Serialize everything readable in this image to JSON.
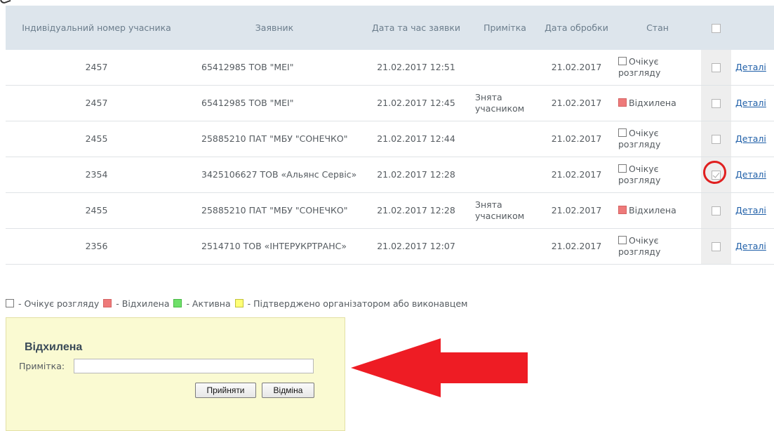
{
  "table": {
    "headers": {
      "number": "Індивідуальний номер учасника",
      "applicant": "Заявник",
      "date": "Дата та час заявки",
      "note": "Примітка",
      "processed": "Дата обробки",
      "status": "Стан"
    },
    "rows": [
      {
        "number": "2457",
        "applicant": "65412985 ТОВ \"МЕІ\"",
        "date": "21.02.2017 12:51",
        "note": "",
        "processed": "21.02.2017",
        "status": "Очікує розгляду",
        "status_type": "waiting",
        "checked": false,
        "link": "Деталі"
      },
      {
        "number": "2457",
        "applicant": "65412985 ТОВ \"МЕІ\"",
        "date": "21.02.2017 12:45",
        "note": "Знята учасником",
        "processed": "21.02.2017",
        "status": "Відхилена",
        "status_type": "rejected",
        "checked": false,
        "link": "Деталі"
      },
      {
        "number": "2455",
        "applicant": "25885210 ПАТ \"МБУ \"СОНЕЧКО\"",
        "date": "21.02.2017 12:44",
        "note": "",
        "processed": "21.02.2017",
        "status": "Очікує розгляду",
        "status_type": "waiting",
        "checked": false,
        "link": "Деталі"
      },
      {
        "number": "2354",
        "applicant": "3425106627 ТОВ «Альянс Сервіс»",
        "date": "21.02.2017 12:28",
        "note": "",
        "processed": "21.02.2017",
        "status": "Очікує розгляду",
        "status_type": "waiting",
        "checked": true,
        "link": "Деталі"
      },
      {
        "number": "2455",
        "applicant": "25885210 ПАТ \"МБУ \"СОНЕЧКО\"",
        "date": "21.02.2017 12:28",
        "note": "Знята учасником",
        "processed": "21.02.2017",
        "status": "Відхилена",
        "status_type": "rejected",
        "checked": false,
        "link": "Деталі"
      },
      {
        "number": "2356",
        "applicant": "2514710 ТОВ «ІНТЕРУКРТРАНС»",
        "date": "21.02.2017 12:07",
        "note": "",
        "processed": "21.02.2017",
        "status": "Очікує розгляду",
        "status_type": "waiting",
        "checked": false,
        "link": "Деталі"
      }
    ]
  },
  "legend": {
    "waiting": "- Очікує розгляду",
    "rejected": "- Відхилена",
    "active": "- Активна",
    "confirmed": "- Підтверджено організатором або виконавцем"
  },
  "panel": {
    "title": "Відхилена",
    "note_label": "Примітка:",
    "note_value": "",
    "accept_label": "Прийняти",
    "cancel_label": "Відміна"
  },
  "colors": {
    "header_bg": "#dde5ec",
    "rejected": "#ee7a7a",
    "active": "#6fe06a",
    "confirmed": "#ffff77",
    "panel_bg": "#fafad2",
    "highlight": "#e02020",
    "link": "#1f5fa8"
  }
}
